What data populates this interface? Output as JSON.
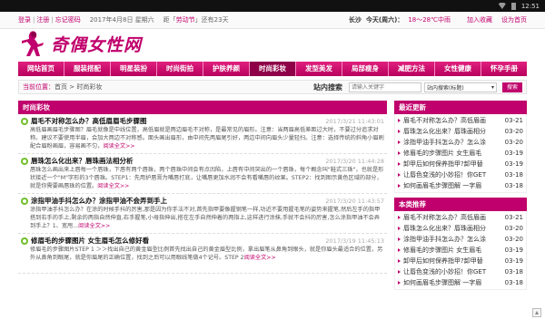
{
  "statusbar": {
    "time": "12:51"
  },
  "topbar": {
    "login": "登录",
    "register": "注册",
    "forgot": "忘记密码",
    "date": "2017年4月8日 星期六",
    "holiday_prefix": "距「",
    "holiday_name": "劳动节",
    "holiday_suffix": "」还有23天",
    "city": "长沙",
    "today": "今天(周六)：",
    "temp": "18～28℃中雨",
    "add_fav": "加入收藏",
    "set_home": "设为首页"
  },
  "logo": {
    "text": "奇偶女性网"
  },
  "nav": {
    "items": [
      "网站首页",
      "服装搭配",
      "明星装扮",
      "时尚街拍",
      "护肤养颜",
      "时尚彩妆",
      "发型美发",
      "局部瘦身",
      "减肥方法",
      "女性健康",
      "怀孕手册"
    ]
  },
  "breadcrumb": {
    "label": "当前位置：",
    "path": "首页 > 时尚彩妆"
  },
  "search": {
    "title": "站内搜索",
    "placeholder": "请输入关键字",
    "select_value": "站内搜索(标题)",
    "button": "搜索"
  },
  "main": {
    "section_title": "时尚彩妆",
    "articles": [
      {
        "title": "眉毛不对称怎么办？高低眉眉毛步骤图",
        "date": "2017/3/21 11:43:01",
        "body": "高低眉画眉毛步骤图？眉毛就像是中线位置，高低眉就是两边眉毛不对称，是最常见的眉形。注意：当两眉高低差距过大时，不要过分追求对称。建议不要使用半眉，会加大两边不对称感。面头画出眉形，由中间先两眉尾引好，两边中间向眉头少量轻扫。注意：选择传统的斜角小眉刷配合眉粉画眉，容易画不匀，",
        "more": "阅读全文>>"
      },
      {
        "title": "唇珠怎么化出来？唇珠画法相分析",
        "date": "2017/3/20 11:44:28",
        "body": "唇珠怎么画出来上唇每一个唇珠，下唇有两个唇珠，两个唇珠中间会有点凹陷，上唇有中间突出的一个唇珠，每个概念叫\"鞋式三珠\"，也就是形状接近一个\"M\"字形的3个唇珠。STEP1：先用护唇膏为嘴唇打底，让嘴唇更加水润不会有看嘴唇的纹果。STEP2：找到图示黄色区域的部分，就是你需要画唇珠的位置。",
        "more": "阅读全文>>"
      },
      {
        "title": "涂指甲油手抖怎么办？涂指甲油不会弄到手上",
        "date": "2017/3/20 11:43:57",
        "body": "涂指甲油手抖怎么办？在涂的时候手抖的厉害,那是因为你手法不对,首先指甲要像握钢笔一样,功近不要用握毛笔的姿势来握笔,然后左手的指甲搭到右手的手上,剩余的两指自然伸直,右手握笔,小母指伸出,搭在左手自然伸着的两指上,这样进行涂抹,手就不会抖的厉害,怎么涂指甲油不会弄到手上？1、宽甩...",
        "more": "阅读全文>>"
      },
      {
        "title": "修眉毛的步骤图片 女生眉毛怎么修好看",
        "date": "2017/3/19 11:45:13",
        "body": "修眉毛的步骤图片STEP 1 ＞＞找出自己的黄金眉型比例首先找出自己的黄金眉型比例，拿出眉笔从鼻角到眼头，就是你眉头最适合的位置，另外从鼻角到眼尾，就是你眉尾的正确位置，找到之后可以用眼线笔做4个记号。STEP 2",
        "more": "阅读全文>>"
      }
    ]
  },
  "side": {
    "latest_title": "最近更新",
    "latest": [
      {
        "title": "眉毛不对称怎么办？高低眉画",
        "date": "03-21"
      },
      {
        "title": "唇珠怎么化出来？唇珠画相分",
        "date": "03-20"
      },
      {
        "title": "涂指甲油手抖怎么办？怎么涂",
        "date": "03-20"
      },
      {
        "title": "修眉毛的步骤图片 女生眉毛",
        "date": "03-19"
      },
      {
        "title": "卸甲后如何保养指甲?卸甲替",
        "date": "03-19"
      },
      {
        "title": "让唇色变浅的小妙招！你GET",
        "date": "03-18"
      },
      {
        "title": "如何画眉毛步骤图解 一字眉",
        "date": "03-18"
      }
    ],
    "recommend_title": "本类推荐",
    "recommend": [
      {
        "title": "眉毛不对称怎么办？高低眉画",
        "date": "03-21"
      },
      {
        "title": "唇珠怎么化出来？唇珠画相分",
        "date": "03-20"
      },
      {
        "title": "涂指甲油手抖怎么办？怎么涂",
        "date": "03-20"
      },
      {
        "title": "修眉毛的步骤图片 女生眉毛",
        "date": "03-19"
      },
      {
        "title": "卸甲后如何保养指甲?卸甲替",
        "date": "03-19"
      },
      {
        "title": "让唇色变浅的小妙招！你GET",
        "date": "03-18"
      },
      {
        "title": "如何画眉毛步骤图解 一字眉",
        "date": "03-18"
      }
    ]
  }
}
